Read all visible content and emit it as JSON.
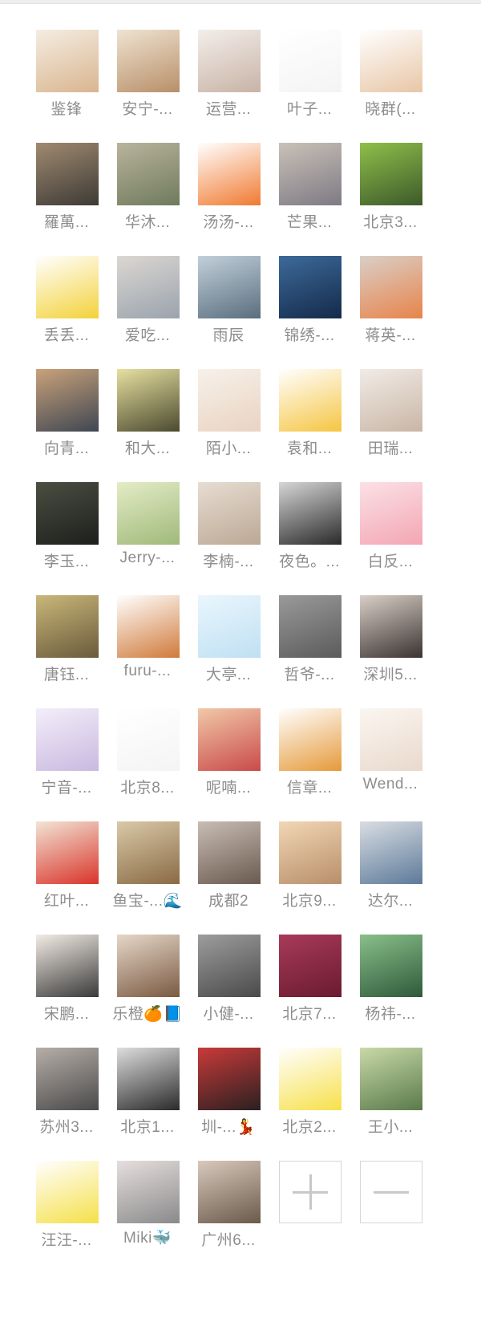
{
  "members": [
    {
      "name": "鉴锋",
      "avatar_icon": "puppy-photo-icon",
      "color": "#d9b58f",
      "color2": "#f4ede2"
    },
    {
      "name": "安宁-...",
      "avatar_icon": "dog-photo-icon",
      "color": "#b88f69",
      "color2": "#efe3d1"
    },
    {
      "name": "运营...",
      "avatar_icon": "anime-girl-icon",
      "color": "#c8b3a6",
      "color2": "#f3eeea"
    },
    {
      "name": "叶子...",
      "avatar_icon": "doodle-sticker-icon",
      "color": "#f4f4f4",
      "color2": "#ffffff"
    },
    {
      "name": "晓群(...",
      "avatar_icon": "cartoon-man-glasses-icon",
      "color": "#e8c6a6",
      "color2": "#ffffff"
    },
    {
      "name": "羅萬...",
      "avatar_icon": "man-in-suit-icon",
      "color": "#3d3a35",
      "color2": "#a08a70"
    },
    {
      "name": "华沐...",
      "avatar_icon": "woman-in-garden-icon",
      "color": "#6f7a5c",
      "color2": "#b9b49d"
    },
    {
      "name": "汤汤-...",
      "avatar_icon": "carrot-cartoon-icon",
      "color": "#f07a30",
      "color2": "#ffffff"
    },
    {
      "name": "芒果...",
      "avatar_icon": "woman-newspaper-icon",
      "color": "#7e7a84",
      "color2": "#c9c1b8"
    },
    {
      "name": "北京3...",
      "avatar_icon": "person-reading-icon",
      "color": "#3d5a2a",
      "color2": "#8fbf4a"
    },
    {
      "name": "丢丢...",
      "avatar_icon": "girl-cartoon-icon",
      "color": "#f3d23a",
      "color2": "#ffffff"
    },
    {
      "name": "爱吃...",
      "avatar_icon": "woman-on-bridge-icon",
      "color": "#9aa3ad",
      "color2": "#dcd7d2"
    },
    {
      "name": "雨辰",
      "avatar_icon": "young-man-glasses-icon",
      "color": "#5a6e7e",
      "color2": "#c2d0da"
    },
    {
      "name": "锦绣-...",
      "avatar_icon": "night-sky-icon",
      "color": "#142a4a",
      "color2": "#3d6a9a"
    },
    {
      "name": "蒋英-...",
      "avatar_icon": "woman-orange-hat-icon",
      "color": "#e8844a",
      "color2": "#d9cfc8"
    },
    {
      "name": "向青...",
      "avatar_icon": "sunset-lake-icon",
      "color": "#3f4652",
      "color2": "#c9a27a"
    },
    {
      "name": "和大...",
      "avatar_icon": "heart-hands-icon",
      "color": "#4b4a2f",
      "color2": "#e7e0a0"
    },
    {
      "name": "陌小...",
      "avatar_icon": "anime-boy-icon",
      "color": "#e9d3c2",
      "color2": "#f7f1ea"
    },
    {
      "name": "袁和...",
      "avatar_icon": "smiley-emoji-icon",
      "color": "#f5c542",
      "color2": "#ffffff"
    },
    {
      "name": "田瑞...",
      "avatar_icon": "girl-glasses-icon",
      "color": "#c9b6a6",
      "color2": "#f1ebe6"
    },
    {
      "name": "李玉...",
      "avatar_icon": "silhouette-night-icon",
      "color": "#1d1f1c",
      "color2": "#4b4e42"
    },
    {
      "name": "Jerry-...",
      "avatar_icon": "umbrella-art-icon",
      "color": "#9fb97a",
      "color2": "#e4ecc6"
    },
    {
      "name": "李楠-...",
      "avatar_icon": "rose-hand-icon",
      "color": "#bba894",
      "color2": "#e7ddd3"
    },
    {
      "name": "夜色。...",
      "avatar_icon": "man-black-hat-icon",
      "color": "#2a2a2a",
      "color2": "#d6d6d6"
    },
    {
      "name": "白反...",
      "avatar_icon": "pink-anime-girl-icon",
      "color": "#f3a6b3",
      "color2": "#fbe1e6"
    },
    {
      "name": "唐钰...",
      "avatar_icon": "presenter-icon",
      "color": "#6a5a3a",
      "color2": "#c9b77a"
    },
    {
      "name": "furu-...",
      "avatar_icon": "orangutan-icon",
      "color": "#d07a3a",
      "color2": "#ffffff"
    },
    {
      "name": "大亭...",
      "avatar_icon": "jingxi-logo-icon",
      "color": "#bfe0f3",
      "color2": "#eaf6fd"
    },
    {
      "name": "哲爷-...",
      "avatar_icon": "cat-meme-icon",
      "color": "#5b5b5b",
      "color2": "#9a9a9a"
    },
    {
      "name": "深圳5...",
      "avatar_icon": "woman-portrait-icon",
      "color": "#3b3330",
      "color2": "#d9cfc8"
    },
    {
      "name": "宁音-...",
      "avatar_icon": "princess-cartoon-icon",
      "color": "#c9b9e0",
      "color2": "#f3eef9"
    },
    {
      "name": "北京8...",
      "avatar_icon": "text-sticker-icon",
      "color": "#f4f4f4",
      "color2": "#ffffff"
    },
    {
      "name": "呢喃...",
      "avatar_icon": "selfie-clown-icon",
      "color": "#c94a4a",
      "color2": "#f1c8a8"
    },
    {
      "name": "信章...",
      "avatar_icon": "chicken-leg-icon",
      "color": "#e59a3a",
      "color2": "#ffffff"
    },
    {
      "name": "Wend...",
      "avatar_icon": "girl-illustration-icon",
      "color": "#e9d9cc",
      "color2": "#fbf6f1"
    },
    {
      "name": "红叶...",
      "avatar_icon": "red-poster-man-icon",
      "color": "#d9342a",
      "color2": "#f2e4d6"
    },
    {
      "name": "鱼宝-...🌊",
      "avatar_icon": "cat-city-icon",
      "color": "#8a6a45",
      "color2": "#d9c9a8"
    },
    {
      "name": "成都2",
      "avatar_icon": "woman-stage-icon",
      "color": "#6a5a50",
      "color2": "#c9bdb3"
    },
    {
      "name": "北京9...",
      "avatar_icon": "woman-bokeh-icon",
      "color": "#b88e6a",
      "color2": "#f2d7b5"
    },
    {
      "name": "达尔...",
      "avatar_icon": "man-denim-icon",
      "color": "#5d7a9a",
      "color2": "#d9dde2"
    },
    {
      "name": "宋鹏...",
      "avatar_icon": "cartoon-boy-icon",
      "color": "#3a3a3a",
      "color2": "#f3ece5"
    },
    {
      "name": "乐橙🍊📘",
      "avatar_icon": "woman-verified-icon",
      "color": "#7a5a42",
      "color2": "#e6d7c9"
    },
    {
      "name": "小健-...",
      "avatar_icon": "cat-figure-icon",
      "color": "#4a4a4a",
      "color2": "#9d9d9d"
    },
    {
      "name": "北京7...",
      "avatar_icon": "tom-cat-icon",
      "color": "#6a1b2f",
      "color2": "#a83a5a"
    },
    {
      "name": "杨祎-...",
      "avatar_icon": "forest-landscape-icon",
      "color": "#2e5a3a",
      "color2": "#8abf8a"
    },
    {
      "name": "苏州3...",
      "avatar_icon": "woman-cat-icon",
      "color": "#4a4a4a",
      "color2": "#b6aea8"
    },
    {
      "name": "北京1...",
      "avatar_icon": "chaplin-icon",
      "color": "#2a2a2a",
      "color2": "#dedede"
    },
    {
      "name": "圳-...💃",
      "avatar_icon": "white-cat-icon",
      "color": "#2a2020",
      "color2": "#c93a3a"
    },
    {
      "name": "北京2...",
      "avatar_icon": "baymax-icon",
      "color": "#f7e04a",
      "color2": "#ffffff"
    },
    {
      "name": "王小...",
      "avatar_icon": "girl-tree-icon",
      "color": "#5a7a4a",
      "color2": "#c9d9a8"
    },
    {
      "name": "汪汪-...",
      "avatar_icon": "moon-face-emoji-icon",
      "color": "#f5e04a",
      "color2": "#ffffff"
    },
    {
      "name": "Miki🐳",
      "avatar_icon": "kitten-icon",
      "color": "#8a8a8a",
      "color2": "#e6dede"
    },
    {
      "name": "广州6...",
      "avatar_icon": "woman-hat-icon",
      "color": "#6a5a4a",
      "color2": "#d9c9bd"
    }
  ],
  "controls": {
    "add_icon": "plus-icon",
    "remove_icon": "minus-icon"
  }
}
